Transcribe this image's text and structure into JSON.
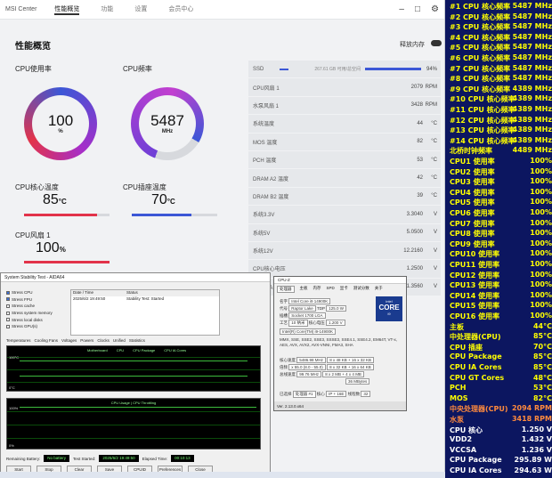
{
  "msi": {
    "title": "MSI Center",
    "tabs": [
      "性能概览",
      "功能",
      "设置",
      "会员中心"
    ],
    "page_title": "性能概览",
    "toggle_label": "释放内存",
    "gauges": [
      {
        "label": "CPU使用率",
        "value": "100",
        "unit": "%",
        "percent": 100
      },
      {
        "label": "CPU频率",
        "value": "5487",
        "unit": "MHz",
        "percent": 78
      }
    ],
    "temps": [
      {
        "label": "CPU核心温度",
        "value": "85",
        "unit": "°C",
        "fill": 0.85,
        "color": "#e2334a"
      },
      {
        "label": "CPU插座温度",
        "value": "70",
        "unit": "°C",
        "fill": 0.7,
        "color": "#3c57d6"
      }
    ],
    "fan": {
      "label": "CPU风扇 1",
      "value": "100",
      "unit": "%",
      "fill": 1.0,
      "color": "#e2334a"
    },
    "ssd": {
      "label": "SSD",
      "total": "267.61 GB 可用/总空间",
      "percent": "94%"
    },
    "stats": [
      {
        "label": "CPU风扇 1",
        "value": "2079",
        "unit": "RPM"
      },
      {
        "label": "水泵风扇 1",
        "value": "3428",
        "unit": "RPM"
      },
      {
        "label": "系统温度",
        "value": "44",
        "unit": "°C"
      },
      {
        "label": "MOS 温度",
        "value": "82",
        "unit": "°C"
      },
      {
        "label": "PCH 温度",
        "value": "53",
        "unit": "°C"
      },
      {
        "label": "DRAM A2 温度",
        "value": "42",
        "unit": "°C"
      },
      {
        "label": "DRAM B2 温度",
        "value": "39",
        "unit": "°C"
      },
      {
        "label": "系统3.3V",
        "value": "3.3040",
        "unit": "V"
      },
      {
        "label": "系统5V",
        "value": "5.0500",
        "unit": "V"
      },
      {
        "label": "系统12V",
        "value": "12.2160",
        "unit": "V"
      },
      {
        "label": "CPU核心电压",
        "value": "1.2500",
        "unit": "V"
      },
      {
        "label": "CPU SA电压",
        "value": "1.3560",
        "unit": "V"
      }
    ]
  },
  "aida": {
    "title": "System Stability Test - AIDA64",
    "checks": [
      {
        "label": "Stress CPU",
        "on": true
      },
      {
        "label": "Stress FPU",
        "on": true
      },
      {
        "label": "Stress cache",
        "on": false
      },
      {
        "label": "Stress system memory",
        "on": false
      },
      {
        "label": "Stress local disks",
        "on": false
      },
      {
        "label": "Stress GPU(s)",
        "on": false
      }
    ],
    "table_headers": [
      "Date / Time",
      "Status"
    ],
    "table_row": [
      "2025/6/2 19:49:50",
      "Stability Test: Started"
    ],
    "tabs": [
      "Temperatures",
      "Cooling Fans",
      "Voltages",
      "Powers",
      "Clocks",
      "Unified",
      "Statistics"
    ],
    "graph1_legend": [
      "Motherboard",
      "CPU",
      "CPU Package",
      "CPU IA Cores"
    ],
    "graph1_ymax": "100°C",
    "graph1_ymin": "0°C",
    "graph2_title": "CPU Usage | CPU Throttling",
    "graph2_ymax": "100%",
    "graph2_ymin": "0%",
    "battery_label": "Remaining Battery:",
    "battery_value": "No battery",
    "started_label": "Test Started:",
    "started_value": "2025/6/2 19:49:50",
    "elapsed_label": "Elapsed Time:",
    "elapsed_value": "00:10:13",
    "buttons": [
      "Start",
      "Stop",
      "Clear",
      "Save",
      "CPUID",
      "Preferences",
      "Close"
    ]
  },
  "cpuz": {
    "title": "CPU-Z",
    "tabs": [
      "处理器",
      "主板",
      "内存",
      "SPD",
      "显卡",
      "测试分数",
      "关于"
    ],
    "name_label": "名字",
    "name_value": "Intel Core i9 14900K",
    "code_label": "代号",
    "code_value": "Raptor Lake",
    "tdp_label": "TDP",
    "tdp_value": "125.0 W",
    "socket_label": "插槽",
    "socket_value": "Socket 1700 LGA",
    "process_label": "工艺",
    "process_value": "10 纳米",
    "vcore_label": "核心电压",
    "vcore_value": "1.200 V",
    "spec_value": "Intel(R) Core(TM) i9-14900K",
    "instr_value": "MMX, SSE, SSE2, SSE3, SSSE3, SSE4.1, SSE4.2, EM64T, VT-x, AES, AVX, AVX2, AVX-VNNI, FMA3, SHA",
    "clock_label": "核心速度",
    "clock_value": "5486.98 MHz",
    "mult_label": "倍频",
    "mult_value": "x 55.0 (8.0 - 55.0)",
    "bus_label": "总线速度",
    "bus_value": "99.76 MHz",
    "cache1": "8 x 48 KB + 16 x 32 KB",
    "cache2": "8 x 32 KB + 16 x 64 KB",
    "cache3": "8 x 2 MB + 4 x 4 MB",
    "cache4": "36 MBytes",
    "select_label": "已选择",
    "select_value": "处理器 #1",
    "cores_label": "核心",
    "cores_value": "IP + 16E",
    "threads_label": "线程数",
    "threads_value": "32",
    "version": "Ver. 2.13.0.x64",
    "logo_brand": "intel",
    "logo_text": "CORE",
    "logo_sub": "i9"
  },
  "panel": {
    "rows": [
      {
        "label": "#1 CPU 核心频率",
        "value": "5487 MHz",
        "color": "#ffff00"
      },
      {
        "label": "#2 CPU 核心频率",
        "value": "5487 MHz",
        "color": "#ffff00"
      },
      {
        "label": "#3 CPU 核心频率",
        "value": "5487 MHz",
        "color": "#ffff00"
      },
      {
        "label": "#4 CPU 核心频率",
        "value": "5487 MHz",
        "color": "#ffff00"
      },
      {
        "label": "#5 CPU 核心频率",
        "value": "5487 MHz",
        "color": "#ffff00"
      },
      {
        "label": "#6 CPU 核心频率",
        "value": "5487 MHz",
        "color": "#ffff00"
      },
      {
        "label": "#7 CPU 核心频率",
        "value": "5487 MHz",
        "color": "#ffff00"
      },
      {
        "label": "#8 CPU 核心频率",
        "value": "5487 MHz",
        "color": "#ffff00"
      },
      {
        "label": "#9 CPU 核心频率",
        "value": "4389 MHz",
        "color": "#ffff00"
      },
      {
        "label": "#10 CPU 核心频率",
        "value": "4389 MHz",
        "color": "#ffff00"
      },
      {
        "label": "#11 CPU 核心频率",
        "value": "4389 MHz",
        "color": "#ffff00"
      },
      {
        "label": "#12 CPU 核心频率",
        "value": "4389 MHz",
        "color": "#ffff00"
      },
      {
        "label": "#13 CPU 核心频率",
        "value": "4389 MHz",
        "color": "#ffff00"
      },
      {
        "label": "#14 CPU 核心频率",
        "value": "4389 MHz",
        "color": "#ffff00"
      },
      {
        "label": "北桥时钟频率",
        "value": "4489 MHz",
        "color": "#ffff00"
      },
      {
        "label": "CPU1 使用率",
        "value": "100%",
        "color": "#ffff00"
      },
      {
        "label": "CPU2 使用率",
        "value": "100%",
        "color": "#ffff00"
      },
      {
        "label": "CPU3 使用率",
        "value": "100%",
        "color": "#ffff00"
      },
      {
        "label": "CPU4 使用率",
        "value": "100%",
        "color": "#ffff00"
      },
      {
        "label": "CPU5 使用率",
        "value": "100%",
        "color": "#ffff00"
      },
      {
        "label": "CPU6 使用率",
        "value": "100%",
        "color": "#ffff00"
      },
      {
        "label": "CPU7 使用率",
        "value": "100%",
        "color": "#ffff00"
      },
      {
        "label": "CPU8 使用率",
        "value": "100%",
        "color": "#ffff00"
      },
      {
        "label": "CPU9 使用率",
        "value": "100%",
        "color": "#ffff00"
      },
      {
        "label": "CPU10 使用率",
        "value": "100%",
        "color": "#ffff00"
      },
      {
        "label": "CPU11 使用率",
        "value": "100%",
        "color": "#ffff00"
      },
      {
        "label": "CPU12 使用率",
        "value": "100%",
        "color": "#ffff00"
      },
      {
        "label": "CPU13 使用率",
        "value": "100%",
        "color": "#ffff00"
      },
      {
        "label": "CPU14 使用率",
        "value": "100%",
        "color": "#ffff00"
      },
      {
        "label": "CPU15 使用率",
        "value": "100%",
        "color": "#ffff00"
      },
      {
        "label": "CPU16 使用率",
        "value": "100%",
        "color": "#ffff00"
      },
      {
        "label": "主板",
        "value": "44°C",
        "color": "#ffff00"
      },
      {
        "label": "中处理器(CPU)",
        "value": "85°C",
        "color": "#ffff00"
      },
      {
        "label": "CPU 插座",
        "value": "70°C",
        "color": "#ffff00"
      },
      {
        "label": "CPU Package",
        "value": "85°C",
        "color": "#ffff00"
      },
      {
        "label": "CPU IA Cores",
        "value": "85°C",
        "color": "#ffff00"
      },
      {
        "label": "CPU GT Cores",
        "value": "48°C",
        "color": "#ffff00"
      },
      {
        "label": "PCH",
        "value": "53°C",
        "color": "#ffff00"
      },
      {
        "label": "MOS",
        "value": "82°C",
        "color": "#ffff00"
      },
      {
        "label": "中央处理器(CPU)",
        "value": "2094 RPM",
        "color": "#ff8a3d"
      },
      {
        "label": "水泵",
        "value": "3418 RPM",
        "color": "#ff8a3d"
      },
      {
        "label": "CPU 核心",
        "value": "1.250 V",
        "color": "#ffffff"
      },
      {
        "label": "VDD2",
        "value": "1.432 V",
        "color": "#ffffff"
      },
      {
        "label": "VCCSA",
        "value": "1.236 V",
        "color": "#ffffff"
      },
      {
        "label": "CPU Package",
        "value": "295.89 W",
        "color": "#ffffff"
      },
      {
        "label": "CPU IA Cores",
        "value": "294.63 W",
        "color": "#ffffff"
      }
    ]
  }
}
